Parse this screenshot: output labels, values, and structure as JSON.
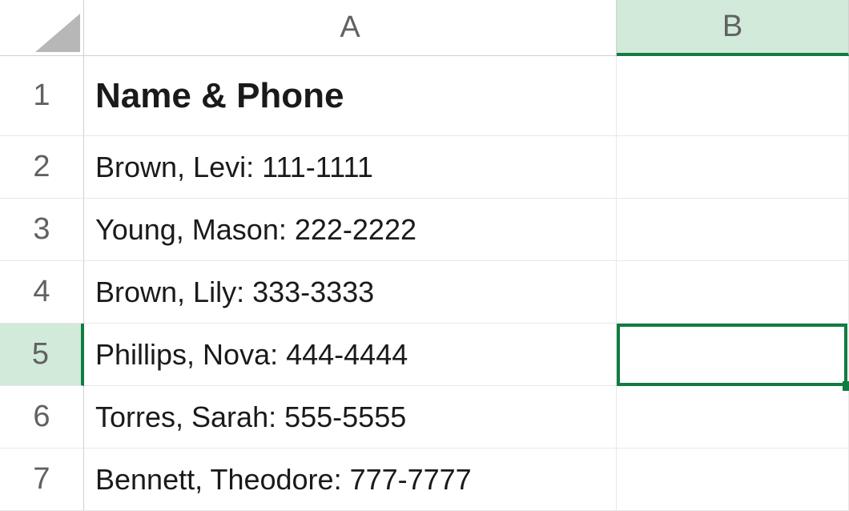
{
  "columns": [
    "A",
    "B"
  ],
  "rows": [
    "1",
    "2",
    "3",
    "4",
    "5",
    "6",
    "7"
  ],
  "selected": {
    "col": "B",
    "row": "5"
  },
  "header_cell": "Name & Phone",
  "data": [
    "Brown, Levi: 111-1111",
    "Young, Mason: 222-2222",
    "Brown, Lily: 333-3333",
    "Phillips, Nova: 444-4444",
    "Torres, Sarah: 555-5555",
    "Bennett, Theodore: 777-7777"
  ],
  "chart_data": {
    "type": "table",
    "columns": [
      "Name & Phone"
    ],
    "rows": [
      [
        "Brown, Levi: 111-1111"
      ],
      [
        "Young, Mason: 222-2222"
      ],
      [
        "Brown, Lily: 333-3333"
      ],
      [
        "Phillips, Nova: 444-4444"
      ],
      [
        "Torres, Sarah: 555-5555"
      ],
      [
        "Bennett, Theodore: 777-7777"
      ]
    ]
  }
}
